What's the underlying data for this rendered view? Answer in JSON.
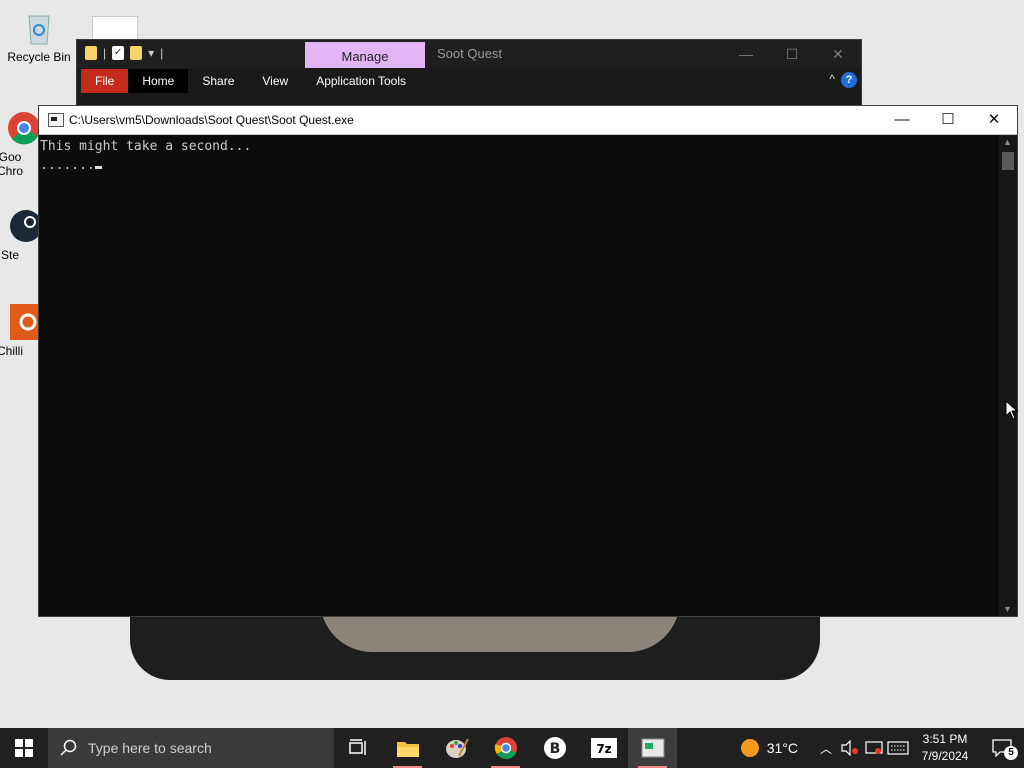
{
  "desktop": {
    "icons": [
      {
        "label": "Recycle Bin"
      },
      {
        "label": "Goo Chro"
      },
      {
        "label": "Ste"
      },
      {
        "label": "Chilli"
      }
    ]
  },
  "explorer": {
    "manage_tab": "Manage",
    "title": "Soot Quest",
    "ribbon_tabs": [
      "File",
      "Home",
      "Share",
      "View",
      "Application Tools"
    ],
    "help": "?"
  },
  "console": {
    "title": "C:\\Users\\vm5\\Downloads\\Soot Quest\\Soot Quest.exe",
    "lines": [
      "This might take a second...",
      "......."
    ],
    "minimize": "—",
    "maximize": "☐",
    "close": "✕"
  },
  "taskbar": {
    "search_placeholder": "Type here to search",
    "weather_temp": "31°C",
    "time": "3:51 PM",
    "date": "7/9/2024",
    "notification_count": "5",
    "pinned": [
      {
        "name": "task-view"
      },
      {
        "name": "file-explorer"
      },
      {
        "name": "paint"
      },
      {
        "name": "chrome"
      },
      {
        "name": "b-app"
      },
      {
        "name": "7zip"
      },
      {
        "name": "console-app",
        "active": true
      }
    ]
  }
}
